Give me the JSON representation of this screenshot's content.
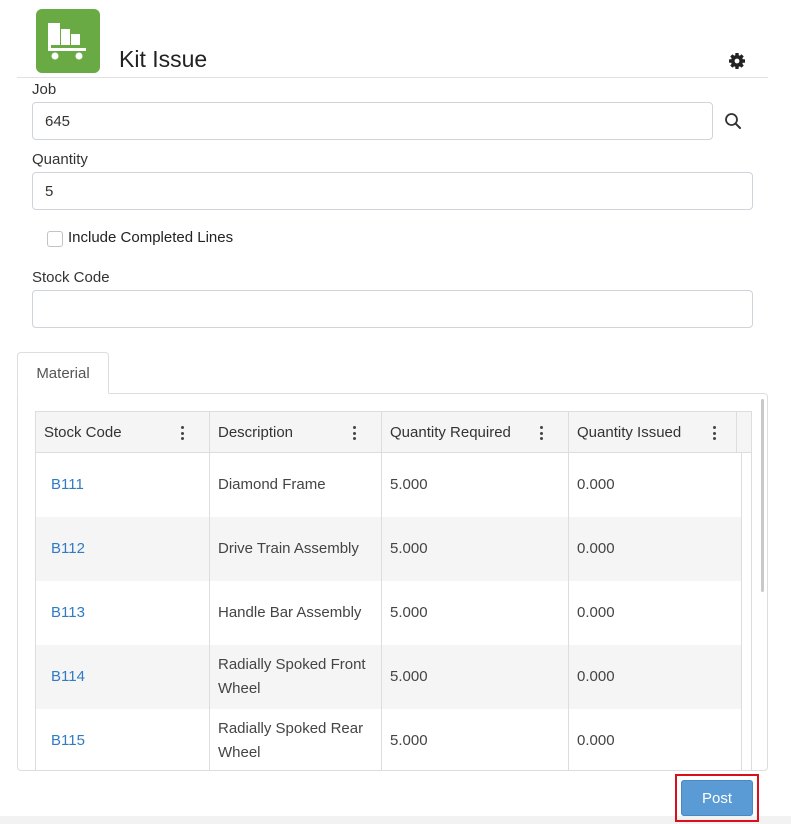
{
  "header": {
    "title": "Kit Issue",
    "app_icon": "cart-boxes-icon",
    "settings_icon": "gear-icon",
    "accent_color": "#6aaa44"
  },
  "form": {
    "job_label": "Job",
    "job_value": "645",
    "quantity_label": "Quantity",
    "quantity_value": "5",
    "include_completed_label": "Include Completed Lines",
    "include_completed_checked": false,
    "stock_code_label": "Stock Code",
    "stock_code_value": ""
  },
  "tabs": [
    {
      "label": "Material",
      "active": true
    }
  ],
  "grid": {
    "columns": [
      "Stock Code",
      "Description",
      "Quantity Required",
      "Quantity Issued"
    ],
    "rows": [
      {
        "stock_code": "B111",
        "description": "Diamond Frame",
        "qty_required": "5.000",
        "qty_issued": "0.000"
      },
      {
        "stock_code": "B112",
        "description": "Drive Train Assembly",
        "qty_required": "5.000",
        "qty_issued": "0.000"
      },
      {
        "stock_code": "B113",
        "description": "Handle Bar Assembly",
        "qty_required": "5.000",
        "qty_issued": "0.000"
      },
      {
        "stock_code": "B114",
        "description": "Radially Spoked Front Wheel",
        "qty_required": "5.000",
        "qty_issued": "0.000"
      },
      {
        "stock_code": "B115",
        "description": "Radially Spoked Rear Wheel",
        "qty_required": "5.000",
        "qty_issued": "0.000"
      }
    ]
  },
  "actions": {
    "post_label": "Post",
    "post_color": "#5b9bd5",
    "highlight_color": "#d9101b"
  }
}
